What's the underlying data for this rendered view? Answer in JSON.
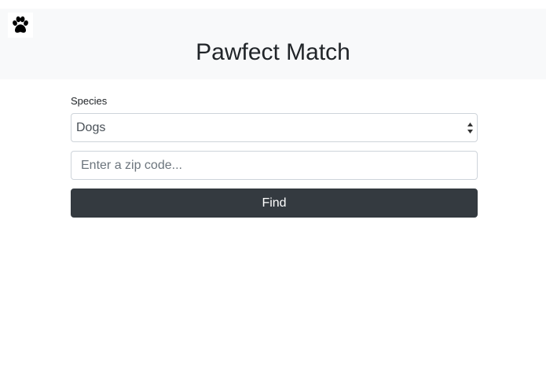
{
  "header": {
    "logo_icon": "paw-icon",
    "title": "Pawfect Match"
  },
  "search_form": {
    "species_label": "Species",
    "species_selected": "Dogs",
    "zip_placeholder": "Enter a zip code...",
    "zip_value": "",
    "find_label": "Find"
  },
  "colors": {
    "header_background": "#f8f9fa",
    "button_background": "#343a40",
    "button_text": "#ffffff",
    "input_border": "#ced4da"
  }
}
